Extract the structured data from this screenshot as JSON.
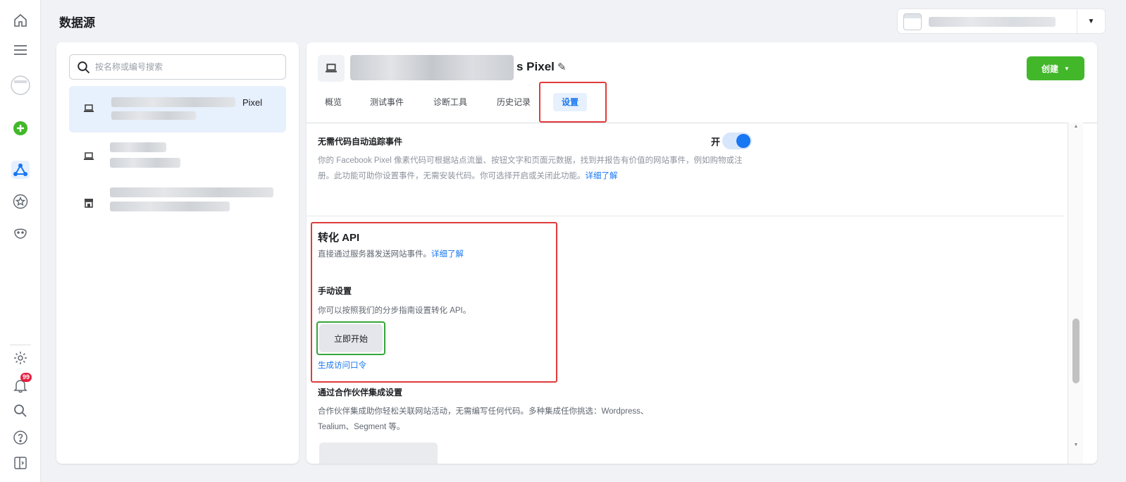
{
  "page": {
    "title": "数据源"
  },
  "rail": {
    "icons": [
      "home-icon",
      "menu-icon",
      "account-avatar-icon",
      "add-icon",
      "data-sources-icon",
      "star-icon",
      "smile-icon",
      "settings-icon",
      "notifications-icon",
      "search-icon",
      "help-icon",
      "panel-toggle-icon"
    ],
    "notification_count": "99"
  },
  "account_switcher": {
    "dropdown_glyph": "▼"
  },
  "search": {
    "placeholder": "按名称或编号搜索"
  },
  "sources": [
    {
      "suffix": "Pixel",
      "selected": true
    },
    {
      "suffix": "",
      "selected": false
    },
    {
      "suffix": "",
      "selected": false
    }
  ],
  "detail": {
    "pixel_name_suffix": "s Pixel",
    "create_button": "创建",
    "tabs": [
      "概览",
      "测试事件",
      "诊断工具",
      "历史记录",
      "设置"
    ],
    "active_tab": "设置",
    "auto_tracking": {
      "title": "无需代码自动追踪事件",
      "toggle_label": "开",
      "toggle_on": true,
      "description": "你的 Facebook Pixel 像素代码可根据站点流量、按钮文字和页面元数据，找到并报告有价值的网站事件，例如购物或注册。此功能可助你设置事件，无需安装代码。你可选择开启或关闭此功能。",
      "link": "详细了解"
    },
    "conversions_api": {
      "title": "转化 API",
      "description": "直接通过服务器发送网站事件。",
      "link": "详细了解",
      "manual_title": "手动设置",
      "manual_description": "你可以按照我们的分步指南设置转化 API。",
      "start_button": "立即开始",
      "token_link": "生成访问口令"
    },
    "partner": {
      "title": "通过合作伙伴集成设置",
      "description_line1": "合作伙伴集成助你轻松关联网站活动，无需编写任何代码。多种集成任你挑选：Wordpress、",
      "description_line2": "Tealium、Segment 等。"
    }
  },
  "colors": {
    "accent": "#1877f2",
    "create_green": "#42b72a",
    "highlight_red": "#e13b3b",
    "highlight_green": "#36a53a"
  }
}
